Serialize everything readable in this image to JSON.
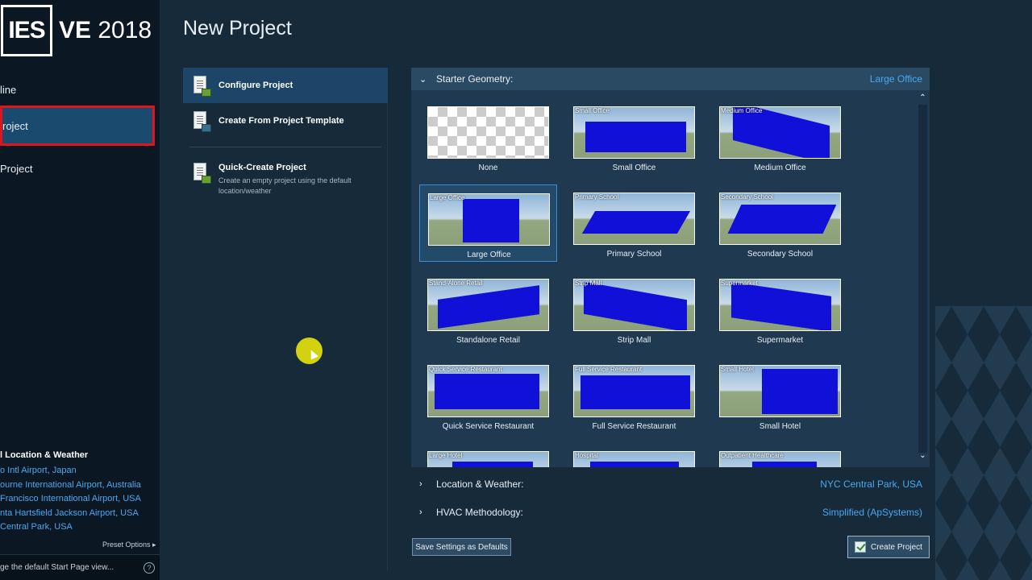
{
  "app": {
    "logo_left": "IES",
    "logo_ve": "VE",
    "logo_year": "2018"
  },
  "sidebar": {
    "items": [
      {
        "label": "line"
      },
      {
        "label": "roject"
      },
      {
        "label": "Project"
      }
    ],
    "location_title": "l Location & Weather",
    "locations": [
      "o Intl Airport, Japan",
      "ourne International Airport, Australia",
      "Francisco International Airport, USA",
      "nta Hartsfield Jackson Airport, USA",
      " Central Park, USA"
    ],
    "preset_options": "Preset Options",
    "footer_text": "ge the default Start Page view...",
    "help_glyph": "?"
  },
  "header": {
    "title": "New Project"
  },
  "options": [
    {
      "label": "Configure Project",
      "desc": ""
    },
    {
      "label": "Create From Project Template",
      "desc": ""
    },
    {
      "label": "Quick-Create Project",
      "desc": "Create an empty project using the default location/weather"
    }
  ],
  "starter": {
    "title": "Starter Geometry:",
    "value": "Large Office",
    "tiles": [
      {
        "label": "None",
        "caption": ""
      },
      {
        "label": "Small Office",
        "caption": "Small Office"
      },
      {
        "label": "Medium Office",
        "caption": "Medium Office"
      },
      {
        "label": "Large Office",
        "caption": "Large Office"
      },
      {
        "label": "Primary School",
        "caption": "Primary School"
      },
      {
        "label": "Secondary School",
        "caption": "Secondary School"
      },
      {
        "label": "Standalone Retail",
        "caption": "Stand-Alone Retail"
      },
      {
        "label": "Strip Mall",
        "caption": "Strip Mall"
      },
      {
        "label": "Supermarket",
        "caption": "Supermarket"
      },
      {
        "label": "Quick Service Restaurant",
        "caption": "Quick Service Restaurant"
      },
      {
        "label": "Full Service Restaurant",
        "caption": "Full Service Restaurant"
      },
      {
        "label": "Small Hotel",
        "caption": "Small Hotel"
      },
      {
        "label": "",
        "caption": "Large Hotel"
      },
      {
        "label": "",
        "caption": "Hospital"
      },
      {
        "label": "",
        "caption": "Outpatient Healthcare"
      }
    ],
    "selected_index": 3
  },
  "location_row": {
    "title": "Location & Weather:",
    "value": "NYC Central Park, USA"
  },
  "hvac_row": {
    "title": "HVAC Methodology:",
    "value": "Simplified (ApSystems)"
  },
  "buttons": {
    "save_defaults": "Save Settings as Defaults",
    "create": "Create Project"
  },
  "colors": {
    "accent": "#4aa8f0",
    "highlight_border": "#e0141e",
    "building": "#1010d8"
  }
}
